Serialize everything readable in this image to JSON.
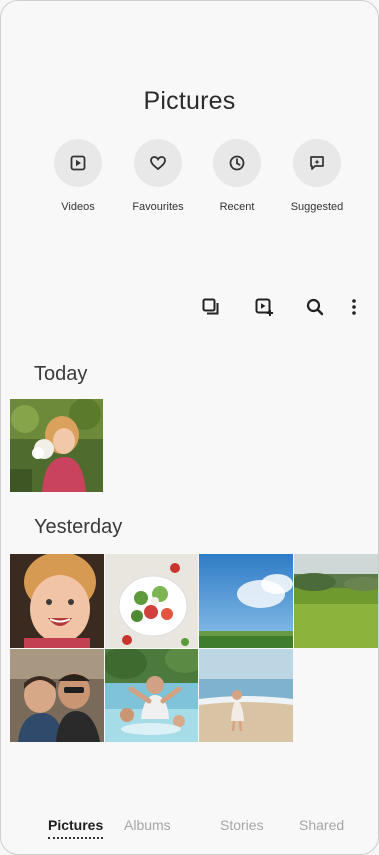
{
  "header": {
    "title": "Pictures"
  },
  "quick_actions": [
    {
      "label": "Videos",
      "icon": "play-square-icon"
    },
    {
      "label": "Favourites",
      "icon": "heart-icon"
    },
    {
      "label": "Recent",
      "icon": "clock-icon"
    },
    {
      "label": "Suggested",
      "icon": "sparkle-chat-icon"
    }
  ],
  "toolbar": {
    "icons": [
      "select-multiple-icon",
      "create-video-icon",
      "search-icon",
      "more-options-icon"
    ]
  },
  "sections": {
    "today": {
      "label": "Today",
      "photo_count": 1
    },
    "yesterday": {
      "label": "Yesterday",
      "photo_count": 7
    }
  },
  "bottom_tabs": [
    {
      "label": "Pictures",
      "active": true
    },
    {
      "label": "Albums",
      "active": false
    },
    {
      "label": "Stories",
      "active": false
    },
    {
      "label": "Shared",
      "active": false
    }
  ]
}
